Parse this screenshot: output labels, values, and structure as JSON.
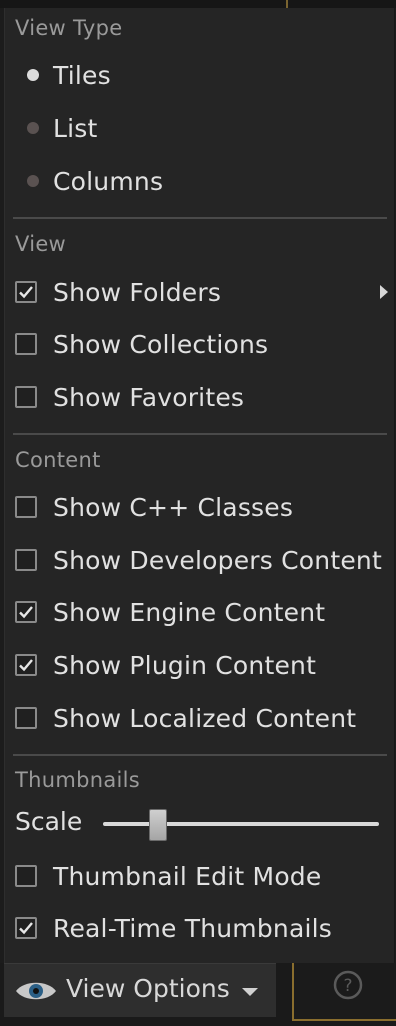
{
  "menu": {
    "view_type": {
      "header": "View Type",
      "options": [
        {
          "label": "Tiles",
          "selected": true
        },
        {
          "label": "List",
          "selected": false
        },
        {
          "label": "Columns",
          "selected": false
        }
      ]
    },
    "view": {
      "header": "View",
      "items": [
        {
          "label": "Show Folders",
          "checked": true,
          "has_submenu": true
        },
        {
          "label": "Show Collections",
          "checked": false
        },
        {
          "label": "Show Favorites",
          "checked": false
        }
      ]
    },
    "content": {
      "header": "Content",
      "items": [
        {
          "label": "Show C++ Classes",
          "checked": false
        },
        {
          "label": "Show Developers Content",
          "checked": false
        },
        {
          "label": "Show Engine Content",
          "checked": true
        },
        {
          "label": "Show Plugin Content",
          "checked": true
        },
        {
          "label": "Show Localized Content",
          "checked": false
        }
      ]
    },
    "thumbnails": {
      "header": "Thumbnails",
      "scale_label": "Scale",
      "scale_value": 0.2,
      "items": [
        {
          "label": "Thumbnail Edit Mode",
          "checked": false
        },
        {
          "label": "Real-Time Thumbnails",
          "checked": true
        }
      ]
    }
  },
  "bottom_bar": {
    "view_options_label": "View Options",
    "view_options_icon": "eye-icon",
    "help_icon": "help-icon",
    "help_glyph": "?"
  },
  "colors": {
    "menu_bg": "#252525",
    "text": "#e1e1e1",
    "header_text": "#9a9a9a",
    "accent_border": "#8a6e2e"
  }
}
